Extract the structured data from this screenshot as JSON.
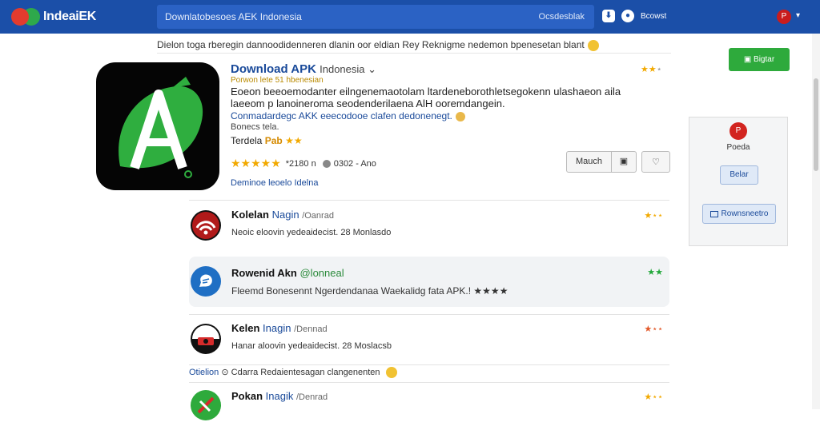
{
  "topbar": {
    "logo_text": "IndeaiEK",
    "search_text": "Downlatobesoes AEK  Indonesia",
    "search_right": "Ocsdesblak",
    "link_label": "Bcowst",
    "avatar_glyph": "P"
  },
  "notice": {
    "text": "Dielon toga rberegin dannoodidenneren dlanin oor eldian Rey Reknigme nedemon bpenesetan blant"
  },
  "featured": {
    "title": "Download APK",
    "title_sub": "Indonesia ⌄",
    "meta": "Porwon lete 51 hbenesian",
    "description": "Eoeon beeoemodanter eilngenemaotolam ltardeneborothletsegokenn ulashaeon aila laeeom p lanoineroma seodenderilaena AlH ooremdangein.",
    "link_text": "Conmadardegc AKK eeecodooe clafen dedonenegt.",
    "sub_line": "Bonecs tela.",
    "rating_label": "Terdela",
    "rating_pill": "Pab",
    "rating_stars": "★★★★★",
    "rating_meta": "*2180 n",
    "size_meta": "0302 - Ano",
    "tag": "Deminoe leoelo Idelna",
    "top_stars": "★★",
    "download_label": "Mauch",
    "download_icon": "▣",
    "fav_icon": "♡"
  },
  "list": [
    {
      "title": "Kolelan",
      "title_blue": "Nagin",
      "title_gray": "/Oanrad",
      "desc": "Neoic eloovin yedeaidecist. 28 Monlasdo",
      "stars": "★⋆⋆",
      "icon_bg": "#111111",
      "icon_fg": "#d62b2b",
      "star_color": "default"
    },
    {
      "title": "Rowenid Akn",
      "title_blue": "@lonneal",
      "title_gray": "",
      "desc": "Fleemd Bonesennt Ngerdendanaa Waekalidg fata APK.! ★★★★",
      "stars": "★★",
      "icon_bg": "#1f6fc4",
      "icon_fg": "#ffffff",
      "star_color": "green"
    },
    {
      "title": "Kelen",
      "title_blue": "Inagin",
      "title_gray": "/Dennad",
      "desc": "Hanar aloovin yedeaidecist. 28 Moslacsb",
      "stars": "★⋆⋆",
      "icon_bg": "#111111",
      "icon_fg": "#d62b2b",
      "star_color": "red"
    },
    {
      "title": "Pokan",
      "title_blue": "Inagik",
      "title_gray": "/Denrad",
      "desc": "",
      "stars": "★⋆⋆",
      "icon_bg": "#2eaa3c",
      "icon_fg": "#d62b2b",
      "star_color": "default"
    }
  ],
  "comment": {
    "prefix": "Otielion",
    "text": "⊙ Cdarra Redaientesagan clangenenten"
  },
  "sidebar": {
    "signup_label": "▣ Bigtar",
    "avatar_glyph": "P",
    "label": "Poeda",
    "button1": "Belar",
    "button2": "Rownsneetro"
  },
  "colors": {
    "brand": "#1b4fa8",
    "accent_green": "#2eaa3c",
    "star": "#f2a900"
  }
}
